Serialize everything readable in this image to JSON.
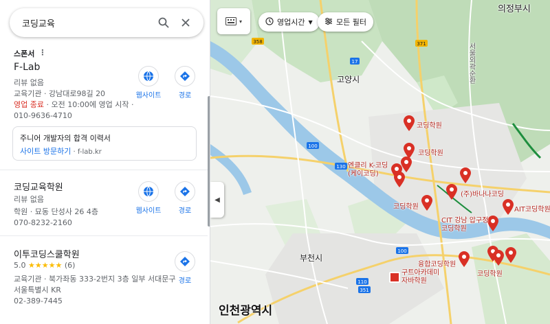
{
  "search": {
    "query": "코딩교육"
  },
  "filters": {
    "hours": "영업시간",
    "all": "모든 필터"
  },
  "sponsor": {
    "label": "스폰서"
  },
  "results": [
    {
      "name": "F-Lab",
      "reviews": "리뷰 없음",
      "category_address": "교육기관 · 강남대로98길 20",
      "status_closed": "영업 종료",
      "status_rest": " · 오전 10:00에 영업 시작 ·",
      "phone": "010-9636-4710",
      "ad_title": "주니어 개발자의 합격 이력서",
      "ad_link": "사이트 방문하기",
      "ad_domain": " · f-lab.kr",
      "website_label": "웹사이트",
      "directions_label": "경로"
    },
    {
      "name": "코딩교육학원",
      "reviews": "리뷰 없음",
      "category_address": "학원 · 묘동 단성사 26 4층",
      "phone": "070-8232-2160",
      "website_label": "웹사이트",
      "directions_label": "경로"
    },
    {
      "name": "이투코딩스쿨학원",
      "rating": "5.0",
      "stars": "★★★★★",
      "review_count": "(6)",
      "category_address": "교육기관 · 북가좌동 333-2번지 3층 일부 서대문구",
      "address2": "서울특별시 KR",
      "phone": "02-389-7445",
      "directions_label": "경로"
    }
  ],
  "map": {
    "labels": {
      "uijeongbu": "의정부시",
      "goyang": "고양시",
      "bucheon": "부천시",
      "incheon": "인천광역시",
      "nam_ring": "서울외곽순환"
    },
    "roads": [
      "358",
      "17",
      "371",
      "100",
      "130",
      "110",
      "351",
      "100"
    ],
    "pins": [
      {
        "label": "코딩학원"
      },
      {
        "label": "코딩학원"
      },
      {
        "label": "엔클리 K-코딩\n(케이코딩)"
      },
      {
        "label": "(주)바나나코딩"
      },
      {
        "label": "코딩학원"
      },
      {
        "label": "AIT코딩학원"
      },
      {
        "label": "CIT 강남 압구정\n코딩학원"
      },
      {
        "label": "융합코딩학원"
      },
      {
        "label": "코딩학원"
      },
      {
        "label": "구트아카데미\n자바학원"
      }
    ]
  },
  "colors": {
    "accent": "#1a73e8",
    "pin": "#d93025",
    "closed": "#d93025"
  }
}
